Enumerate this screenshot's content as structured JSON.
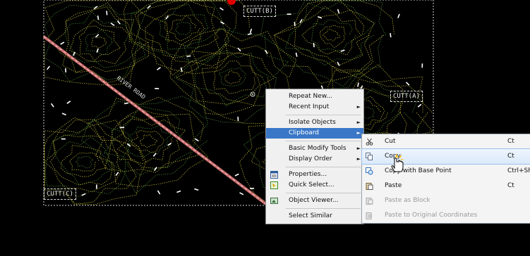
{
  "drawing": {
    "labels": [
      "CUTT(B)",
      "CUTT(A)",
      "CUTT(C)",
      "RIVER ROAD"
    ]
  },
  "context_menu": {
    "items": [
      {
        "label": "Repeat New...",
        "submenu": false
      },
      {
        "label": "Recent Input",
        "submenu": true
      },
      {
        "label": "Isolate Objects",
        "submenu": true
      },
      {
        "label": "Clipboard",
        "submenu": true,
        "active": true
      },
      {
        "label": "Basic Modify Tools",
        "submenu": true
      },
      {
        "label": "Display Order",
        "submenu": true
      },
      {
        "label": "Properties...",
        "icon": "properties-icon"
      },
      {
        "label": "Quick Select...",
        "icon": "quick-select-icon"
      },
      {
        "label": "Object Viewer...",
        "icon": "object-viewer-icon"
      },
      {
        "label": "Select Similar"
      }
    ]
  },
  "clipboard_menu": {
    "items": [
      {
        "label": "Cut",
        "shortcut": "Ct",
        "icon": "scissors-icon"
      },
      {
        "label": "Copy",
        "shortcut": "Ct",
        "icon": "copy-icon",
        "hover": true
      },
      {
        "label": "Copy with Base Point",
        "shortcut": "Ctrl+Shi",
        "icon": "copy-base-point-icon"
      },
      {
        "label": "Paste",
        "shortcut": "Ct",
        "icon": "paste-icon"
      },
      {
        "label": "Paste as Block",
        "shortcut": "",
        "icon": "paste-block-icon",
        "disabled": true
      },
      {
        "label": "Paste to Original Coordinates",
        "shortcut": "",
        "icon": "paste-original-icon",
        "disabled": true
      }
    ]
  },
  "colors": {
    "contour_yellow": "#c9c23a",
    "contour_green": "#4f8f3a",
    "road": "#c86a6a",
    "menu_active": "#3a78c7",
    "hover_fill": "#dbe9fa"
  }
}
